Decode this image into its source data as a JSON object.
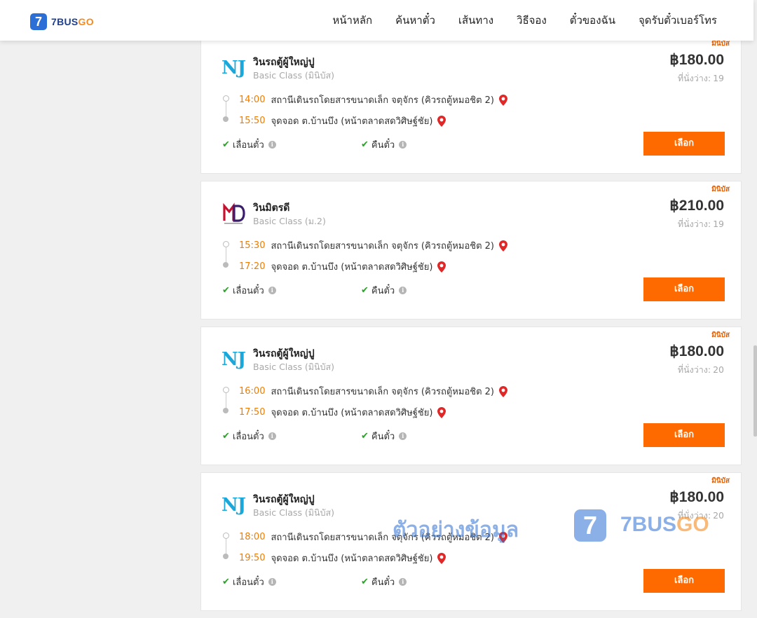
{
  "header": {
    "logo_digit": "7",
    "logo_text_a": "7BUS",
    "logo_text_b": "GO",
    "nav": [
      {
        "label": "หน้าหลัก",
        "name": "nav-home"
      },
      {
        "label": "ค้นหาตั๋ว",
        "name": "nav-search-tickets"
      },
      {
        "label": "เส้นทาง",
        "name": "nav-routes"
      },
      {
        "label": "วิธีจอง",
        "name": "nav-how-to-book"
      },
      {
        "label": "ตั๋วของฉัน",
        "name": "nav-my-tickets"
      },
      {
        "label": "จุดรับตั๋วเบอร์โทร",
        "name": "nav-ticket-pickup"
      }
    ]
  },
  "colors": {
    "accent": "#ff6a00",
    "time": "#ef7d00",
    "brand_blue": "#2b6fd6",
    "check": "#2ca02c"
  },
  "cards": [
    {
      "badge": "มินิบัส",
      "logo": "NJ",
      "operator": "วินรถตู้ผู้ใหญ่ปู",
      "class": "Basic Class (มินิบัส)",
      "price": "฿180.00",
      "seats_label": "ที่นั่งว่าง:",
      "seats": "19",
      "depart_time": "14:00",
      "depart_place": "สถานีเดินรถโดยสารขนาดเล็ก จตุจักร (คิวรถตู้หมอชิต 2)",
      "arrive_time": "15:50",
      "arrive_place": "จุดจอด ต.บ้านบึง (หน้าตลาดสดวิศิษฐ์ชัย)",
      "feature_1": "เลื่อนตั๋ว",
      "feature_2": "คืนตั๋ว",
      "button": "เลือก"
    },
    {
      "badge": "มินิบัส",
      "logo": "MD",
      "operator": "วินมิตรดี",
      "class": "Basic Class (ม.2)",
      "price": "฿210.00",
      "seats_label": "ที่นั่งว่าง:",
      "seats": "19",
      "depart_time": "15:30",
      "depart_place": "สถานีเดินรถโดยสารขนาดเล็ก จตุจักร (คิวรถตู้หมอชิต 2)",
      "arrive_time": "17:20",
      "arrive_place": "จุดจอด ต.บ้านบึง (หน้าตลาดสดวิศิษฐ์ชัย)",
      "feature_1": "เลื่อนตั๋ว",
      "feature_2": "คืนตั๋ว",
      "button": "เลือก"
    },
    {
      "badge": "มินิบัส",
      "logo": "NJ",
      "operator": "วินรถตู้ผู้ใหญ่ปู",
      "class": "Basic Class (มินิบัส)",
      "price": "฿180.00",
      "seats_label": "ที่นั่งว่าง:",
      "seats": "20",
      "depart_time": "16:00",
      "depart_place": "สถานีเดินรถโดยสารขนาดเล็ก จตุจักร (คิวรถตู้หมอชิต 2)",
      "arrive_time": "17:50",
      "arrive_place": "จุดจอด ต.บ้านบึง (หน้าตลาดสดวิศิษฐ์ชัย)",
      "feature_1": "เลื่อนตั๋ว",
      "feature_2": "คืนตั๋ว",
      "button": "เลือก"
    },
    {
      "badge": "มินิบัส",
      "logo": "NJ",
      "operator": "วินรถตู้ผู้ใหญ่ปู",
      "class": "Basic Class (มินิบัส)",
      "price": "฿180.00",
      "seats_label": "ที่นั่งว่าง:",
      "seats": "20",
      "depart_time": "18:00",
      "depart_place": "สถานีเดินรถโดยสารขนาดเล็ก จตุจักร (คิวรถตู้หมอชิต 2)",
      "arrive_time": "19:50",
      "arrive_place": "จุดจอด ต.บ้านบึง (หน้าตลาดสดวิศิษฐ์ชัย)",
      "feature_1": "เลื่อนตั๋ว",
      "feature_2": "คืนตั๋ว",
      "button": "เลือก"
    }
  ],
  "watermark": {
    "text": "ตัวอย่างข้อมูล",
    "digit": "7",
    "brand_a": "7BUS",
    "brand_b": "GO"
  }
}
